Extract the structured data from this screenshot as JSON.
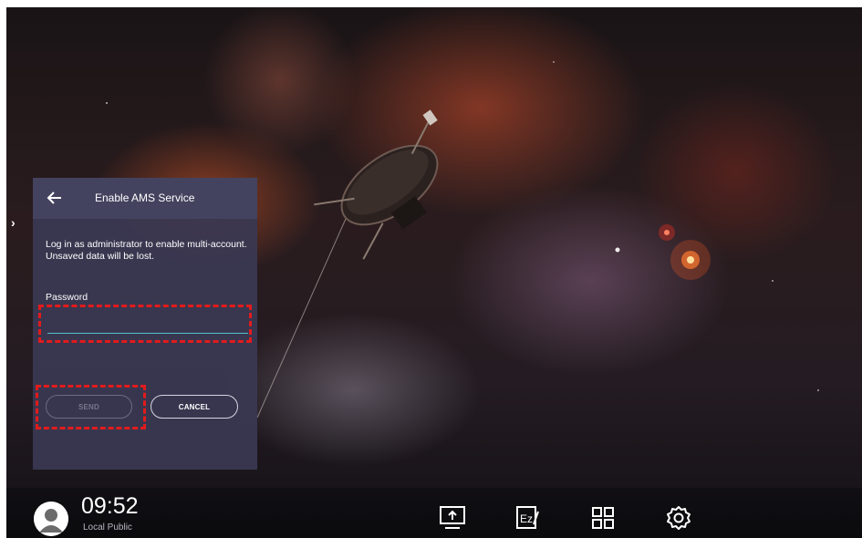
{
  "dialog": {
    "title": "Enable AMS Service",
    "message": "Log in as administrator to enable multi-account. Unsaved data will be lost.",
    "password_label": "Password",
    "password_value": "",
    "password_placeholder": "",
    "send_label": "SEND",
    "cancel_label": "CANCEL"
  },
  "taskbar": {
    "time": "09:52",
    "user_label": "Local Public",
    "dock_icons": [
      "screen-share-icon",
      "ez-write-icon",
      "apps-grid-icon",
      "settings-icon"
    ]
  },
  "colors": {
    "dialog_bg": "#3a3852",
    "header_bg": "#44435f",
    "input_underline": "#4fc1c7",
    "highlight": "#e21b1b"
  }
}
